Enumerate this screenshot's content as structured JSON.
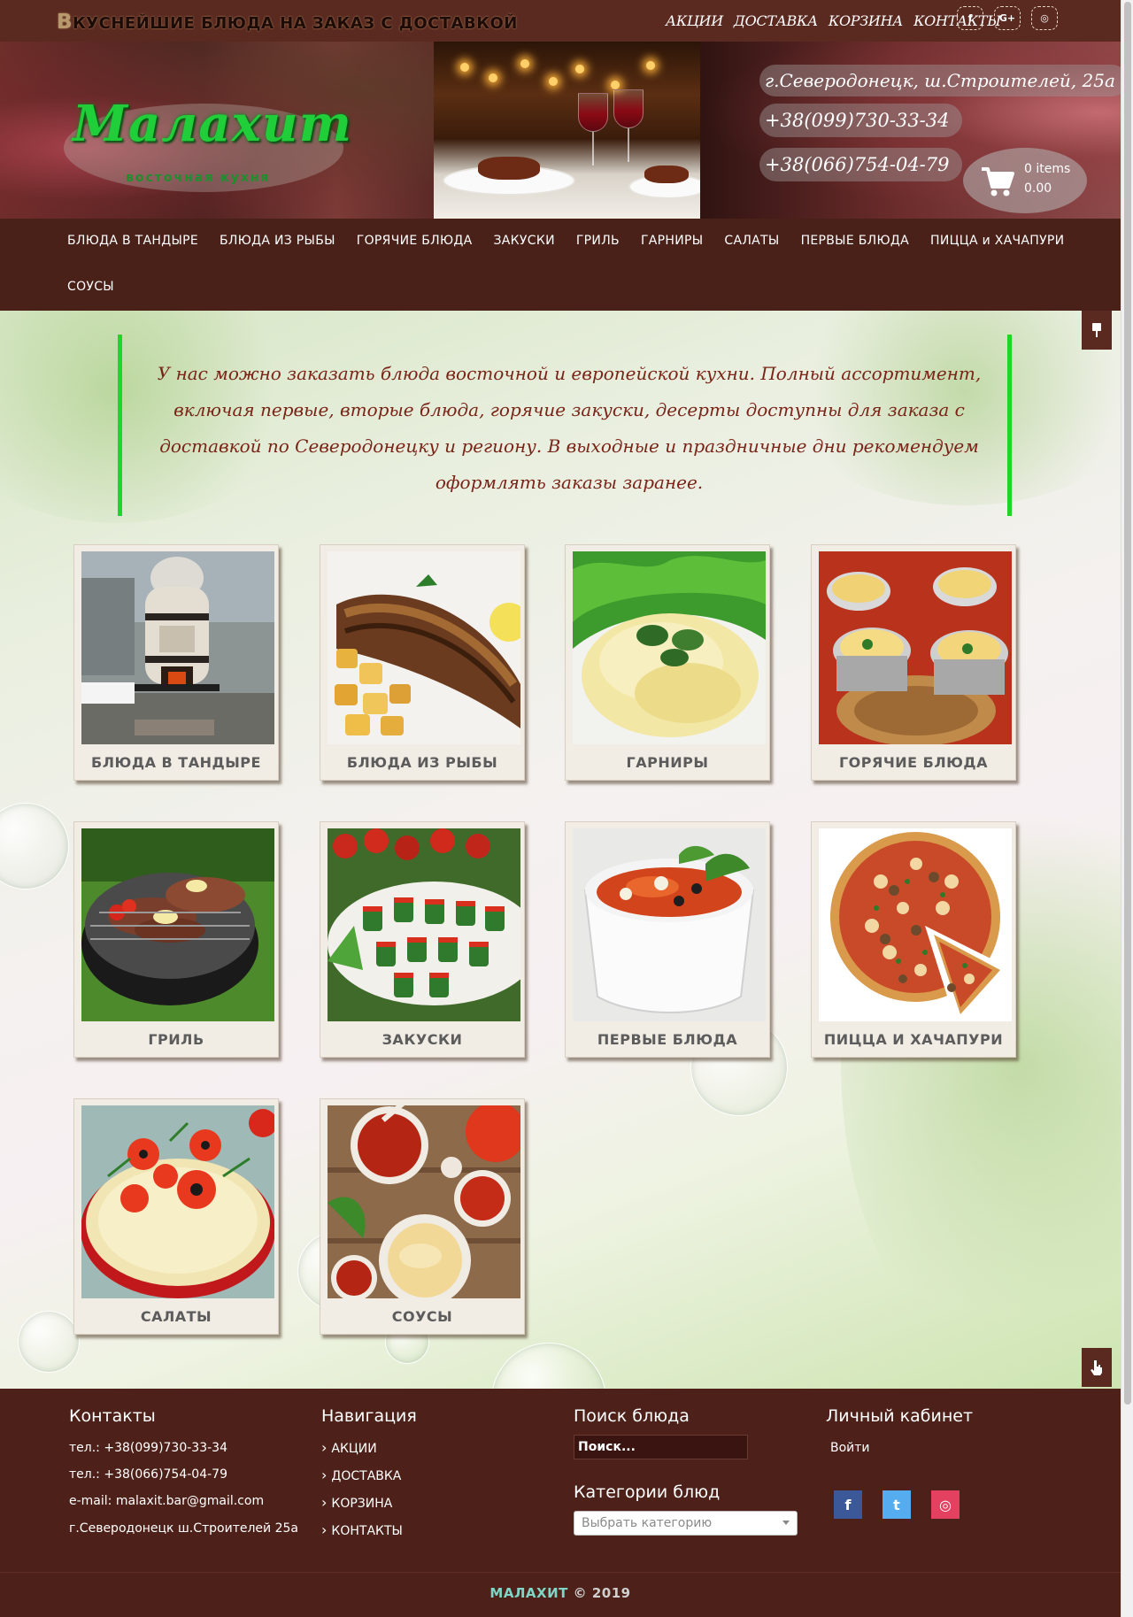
{
  "topbar": {
    "tagline_first": "В",
    "tagline_rest": "куснейшие блюда на заказ с доставкой",
    "links": [
      "АКЦИИ",
      "ДОСТАВКА",
      "КОРЗИНА",
      "КОНТАКТЫ"
    ],
    "social": [
      {
        "icon": "facebook-icon",
        "glyph": "f"
      },
      {
        "icon": "google-plus-icon",
        "glyph": "G+"
      },
      {
        "icon": "instagram-icon",
        "glyph": "◎"
      }
    ]
  },
  "header": {
    "logo": "Малахит",
    "logo_sub": "восточная кухня",
    "address": "г.Северодонецк, ш.Строителей, 25а",
    "phone1": "+38(099)730-33-34",
    "phone2": "+38(066)754-04-79",
    "cart_items": "0 items",
    "cart_total": "0.00"
  },
  "mainnav": {
    "row1": [
      "БЛЮДА В ТАНДЫРЕ",
      "БЛЮДА ИЗ РЫБЫ",
      "ГОРЯЧИЕ БЛЮДА",
      "ЗАКУСКИ",
      "ГРИЛЬ",
      "ГАРНИРЫ",
      "САЛАТЫ",
      "ПЕРВЫЕ БЛЮДА",
      "ПИЦЦА и ХАЧАПУРИ"
    ],
    "row2": [
      "СОУСЫ"
    ]
  },
  "intro": "У нас можно заказать блюда восточной и европейской кухни. Полный ассортимент, включая первые, вторые блюда, горячие закуски, десерты доступны для заказа с доставкой по Северодонецку и региону. В выходные и праздничные дни рекомендуем оформлять заказы заранее.",
  "categories": [
    {
      "label": "Блюда в тандыре",
      "image": "tandoor"
    },
    {
      "label": "Блюда из рыбы",
      "image": "fish"
    },
    {
      "label": "Гарниры",
      "image": "mash"
    },
    {
      "label": "Горячие блюда",
      "image": "julienne"
    },
    {
      "label": "Гриль",
      "image": "grill"
    },
    {
      "label": "Закуски",
      "image": "appetizer"
    },
    {
      "label": "Первые блюда",
      "image": "soup"
    },
    {
      "label": "Пицца и хачапури",
      "image": "pizza"
    },
    {
      "label": "Салаты",
      "image": "salad"
    },
    {
      "label": "Соусы",
      "image": "sauce"
    }
  ],
  "footer": {
    "contacts": {
      "title": "Контакты",
      "tel1": "тел.: +38(099)730-33-34",
      "tel2": "тел.:  +38(066)754-04-79",
      "email": "e-mail: malaxit.bar@gmail.com",
      "address": "г.Северодонецк ш.Строителей 25а"
    },
    "navigation": {
      "title": "Навигация",
      "links": [
        "АКЦИИ",
        "ДОСТАВКА",
        "КОРЗИНА",
        "КОНТАКТЫ"
      ]
    },
    "search": {
      "title": "Поиск блюда",
      "placeholder": "Поиск..."
    },
    "category_select": {
      "title": "Категории блюд",
      "placeholder": "Выбрать категорию"
    },
    "account": {
      "title": "Личный кабинет",
      "login": "Войти"
    },
    "social": [
      {
        "icon": "facebook-icon",
        "glyph": "f",
        "color": "#3b5998"
      },
      {
        "icon": "twitter-icon",
        "glyph": "t",
        "color": "#55acee"
      },
      {
        "icon": "instagram-icon",
        "glyph": "◎",
        "color": "#e4405f"
      }
    ]
  },
  "copyright": {
    "brand": "МАЛАХИТ",
    "text": " © 2019"
  },
  "colors": {
    "brown_dark": "#4d2119",
    "accent_green": "#1fd626",
    "intro_text": "#7a2418"
  }
}
